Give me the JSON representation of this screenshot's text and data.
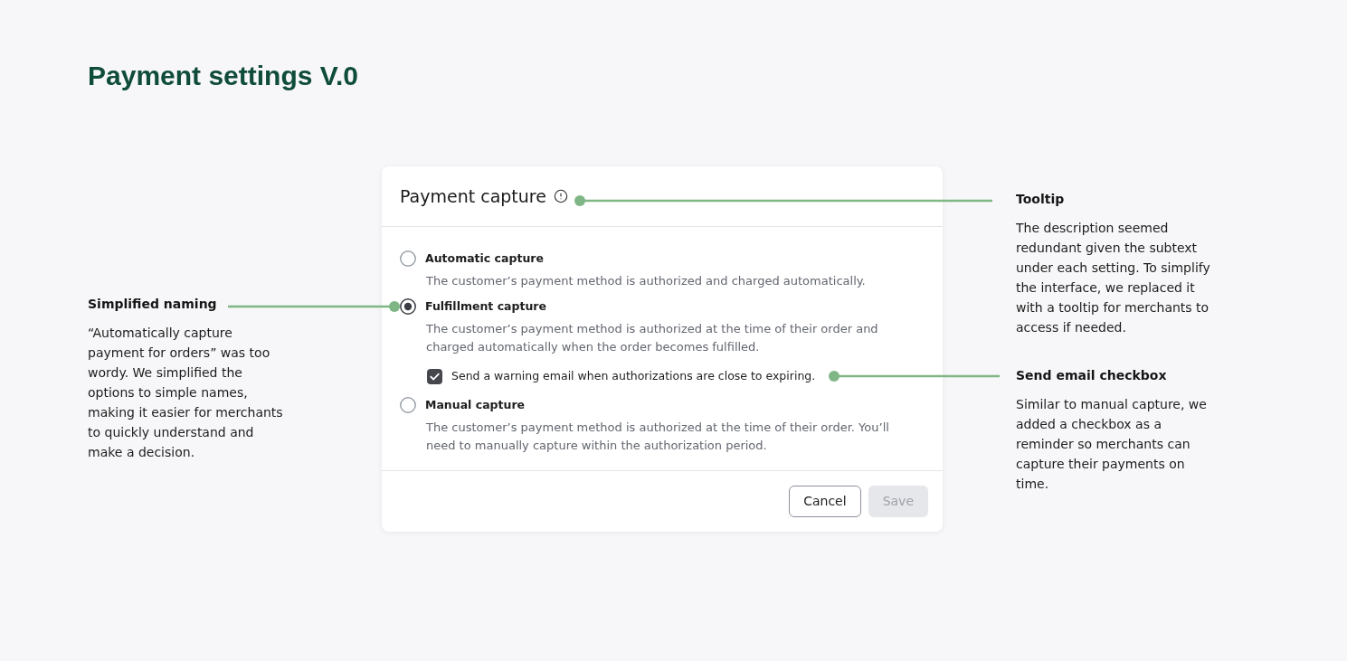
{
  "page_title": "Payment settings V.0",
  "notes_left": [
    {
      "title": "Simplified naming",
      "text": "“Automatically capture payment for orders” was too wordy. We simplified the options to simple names, making it easier for merchants to quickly understand and make a decision."
    }
  ],
  "card": {
    "title": "Payment capture",
    "options": [
      {
        "label": "Automatic capture",
        "description": "The customer’s payment method is authorized and charged automatically.",
        "selected": false
      },
      {
        "label": "Fulfillment capture",
        "description": "The customer’s payment method is authorized at the time of their order and charged automatically when the order becomes fulfilled.",
        "selected": true,
        "checkbox": {
          "label": "Send a warning email when authorizations are close to expiring.",
          "checked": true
        }
      },
      {
        "label": "Manual capture",
        "description": "The customer’s payment method is authorized at the time of their order. You’ll need to manually capture within the authorization period.",
        "selected": false
      }
    ],
    "buttons": [
      {
        "label": "Cancel",
        "disabled": false
      },
      {
        "label": "Save",
        "disabled": true
      }
    ]
  },
  "notes_right": [
    {
      "title": "Tooltip",
      "text": "The description seemed redundant given the subtext under each setting. To simplify the interface, we replaced it with a tooltip for merchants to access if needed."
    },
    {
      "title": "Send email checkbox",
      "text": "Similar to manual capture, we added a checkbox as a reminder so merchants can capture their payments on time."
    }
  ]
}
